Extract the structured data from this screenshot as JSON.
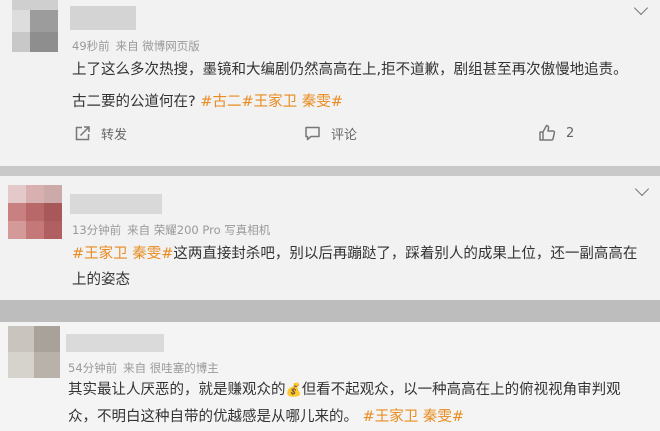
{
  "comments": [
    {
      "time": "49秒前",
      "source": "来自 微博网页版",
      "line1": "上了这么多次热搜，墨镜和大编剧仍然高高在上,拒不道歉，剧组甚至再次傲慢地追责。",
      "line2_plain": "古二要的公道何在? ",
      "line2_tags": "#古二#王家卫 秦雯#",
      "actions": {
        "repost": "转发",
        "comment": "评论",
        "like_count": "2"
      }
    },
    {
      "time": "13分钟前",
      "source": "来自 荣耀200 Pro 写真相机",
      "tag": "#王家卫 秦雯#",
      "line1_rest": "这两直接封杀吧，别以后再蹦跶了，踩着别人的成果上位，还一副高高在",
      "line2": "上的姿态"
    },
    {
      "time": "54分钟前",
      "source": "来自 很哇塞的博主",
      "line1_a": "其实最让人厌恶的，就是赚观众的",
      "emoji": "💰",
      "line1_b": "但看不起观众，以一种高高在上的俯视视角审判观",
      "line2_plain": "众，不明白这种自带的优越感是从哪儿来的。 ",
      "line2_tag": "#王家卫 秦雯#"
    }
  ],
  "colors": {
    "background": "#f2f2f2",
    "topic": "#e98b1f",
    "meta": "#999999",
    "text": "#333333"
  },
  "icons": [
    "chevron-down-icon",
    "repost-icon",
    "comment-icon",
    "like-icon"
  ]
}
